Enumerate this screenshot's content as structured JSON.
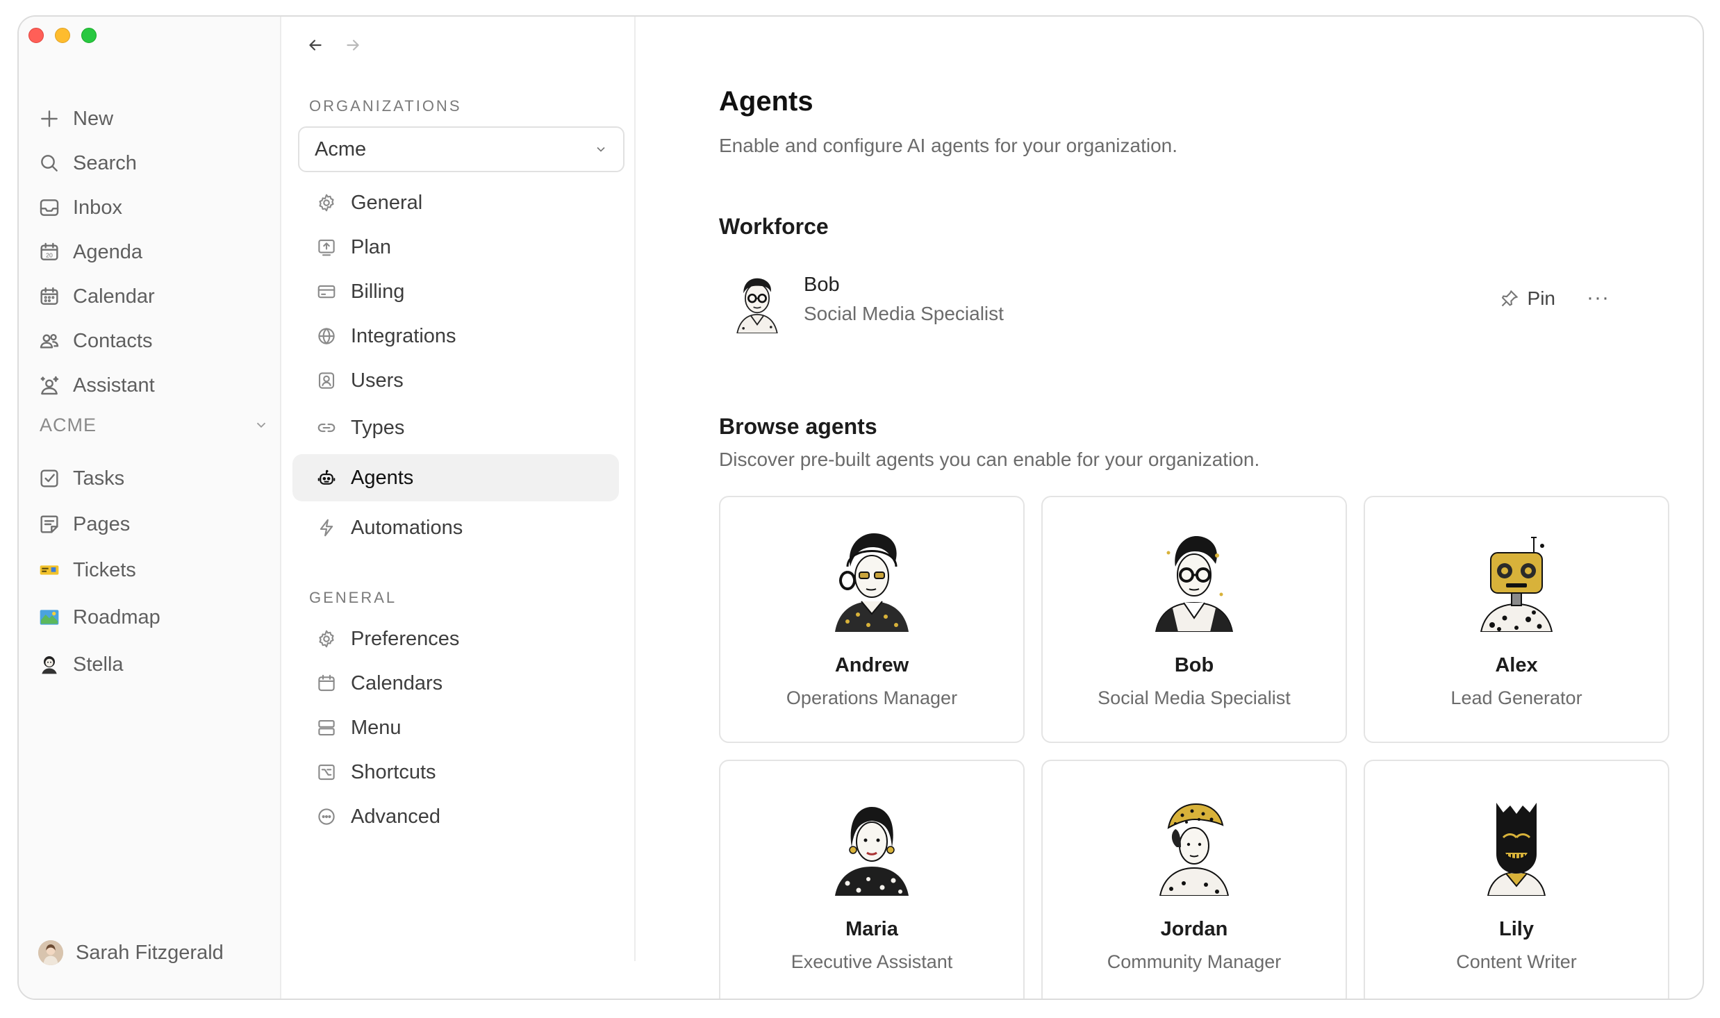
{
  "sidebar": {
    "items": [
      {
        "label": "New",
        "icon": "plus-icon"
      },
      {
        "label": "Search",
        "icon": "search-icon"
      },
      {
        "label": "Inbox",
        "icon": "inbox-icon"
      },
      {
        "label": "Agenda",
        "icon": "agenda-icon"
      },
      {
        "label": "Calendar",
        "icon": "calendar-icon"
      },
      {
        "label": "Contacts",
        "icon": "contacts-icon"
      },
      {
        "label": "Assistant",
        "icon": "assistant-icon"
      }
    ],
    "group_label": "ACME",
    "group_items": [
      {
        "label": "Tasks",
        "icon": "tasks-icon"
      },
      {
        "label": "Pages",
        "icon": "pages-icon"
      },
      {
        "label": "Tickets",
        "icon": "ticket-emoji-icon"
      },
      {
        "label": "Roadmap",
        "icon": "map-emoji-icon"
      },
      {
        "label": "Stella",
        "icon": "stella-avatar-icon"
      }
    ],
    "user": "Sarah Fitzgerald"
  },
  "settings": {
    "organizations_label": "ORGANIZATIONS",
    "org_selected": "Acme",
    "org_items": [
      {
        "label": "General",
        "icon": "gear-icon"
      },
      {
        "label": "Plan",
        "icon": "plan-icon"
      },
      {
        "label": "Billing",
        "icon": "credit-card-icon"
      },
      {
        "label": "Integrations",
        "icon": "globe-icon"
      },
      {
        "label": "Users",
        "icon": "user-badge-icon"
      },
      {
        "label": "Types",
        "icon": "link-icon"
      },
      {
        "label": "Agents",
        "icon": "robot-icon"
      },
      {
        "label": "Automations",
        "icon": "bolt-icon"
      }
    ],
    "general_label": "GENERAL",
    "general_items": [
      {
        "label": "Preferences",
        "icon": "gear-icon"
      },
      {
        "label": "Calendars",
        "icon": "calendar-icon"
      },
      {
        "label": "Menu",
        "icon": "menu-icon"
      },
      {
        "label": "Shortcuts",
        "icon": "shortcut-icon"
      },
      {
        "label": "Advanced",
        "icon": "more-circle-icon"
      }
    ]
  },
  "main": {
    "title": "Agents",
    "subtitle": "Enable and configure AI agents for your organization.",
    "workforce_heading": "Workforce",
    "workforce": [
      {
        "name": "Bob",
        "role": "Social Media Specialist",
        "pin_label": "Pin",
        "more_label": "···"
      }
    ],
    "browse_heading": "Browse agents",
    "browse_subtitle": "Discover pre-built agents you can enable for your organization.",
    "agents": [
      {
        "name": "Andrew",
        "role": "Operations Manager"
      },
      {
        "name": "Bob",
        "role": "Social Media Specialist"
      },
      {
        "name": "Alex",
        "role": "Lead Generator"
      },
      {
        "name": "Maria",
        "role": "Executive Assistant"
      },
      {
        "name": "Jordan",
        "role": "Community Manager"
      },
      {
        "name": "Lily",
        "role": "Content Writer"
      }
    ]
  }
}
